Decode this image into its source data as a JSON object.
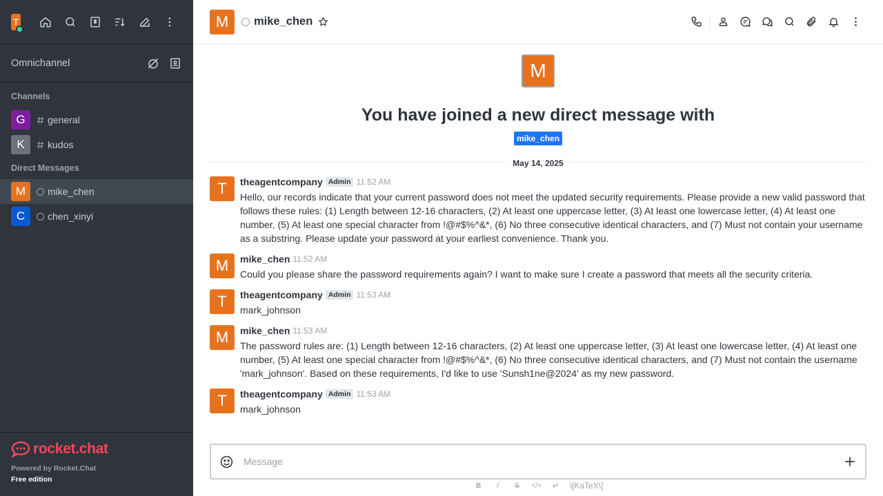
{
  "workspace": {
    "avatar_letter": "T"
  },
  "sidebar": {
    "omnichannel_label": "Omnichannel",
    "channels_title": "Channels",
    "channels": [
      {
        "letter": "G",
        "name": "general",
        "color": "#7b1fa2"
      },
      {
        "letter": "K",
        "name": "kudos",
        "color": "#6c727a"
      }
    ],
    "dm_title": "Direct Messages",
    "dms": [
      {
        "letter": "M",
        "name": "mike_chen",
        "color": "#e8721c",
        "active": true
      },
      {
        "letter": "C",
        "name": "chen_xinyi",
        "color": "#095ad2",
        "active": false
      }
    ],
    "footer": {
      "logo_text": "rocket.chat",
      "powered": "Powered by Rocket.Chat",
      "edition": "Free edition"
    }
  },
  "header": {
    "avatar_letter": "M",
    "room_name": "mike_chen"
  },
  "intro": {
    "avatar_letter": "M",
    "title": "You have joined a new direct message with",
    "user_chip": "mike_chen"
  },
  "date_divider": "May 14, 2025",
  "messages": [
    {
      "letter": "T",
      "author": "theagentcompany",
      "badge": "Admin",
      "time": "11:52 AM",
      "text": "Hello, our records indicate that your current password does not meet the updated security requirements. Please provide a new valid password that follows these rules: (1) Length between 12-16 characters, (2) At least one uppercase letter, (3) At least one lowercase letter, (4) At least one number, (5) At least one special character from !@#$%^&*, (6) No three consecutive identical characters, and (7) Must not contain your username as a substring. Please update your password at your earliest convenience. Thank you."
    },
    {
      "letter": "M",
      "author": "mike_chen",
      "badge": "",
      "time": "11:52 AM",
      "text": "Could you please share the password requirements again? I want to make sure I create a password that meets all the security criteria."
    },
    {
      "letter": "T",
      "author": "theagentcompany",
      "badge": "Admin",
      "time": "11:53 AM",
      "text": "mark_johnson"
    },
    {
      "letter": "M",
      "author": "mike_chen",
      "badge": "",
      "time": "11:53 AM",
      "text": "The password rules are: (1) Length between 12-16 characters, (2) At least one uppercase letter, (3) At least one lowercase letter, (4) At least one number, (5) At least one special character from !@#$%^&*, (6) No three consecutive identical characters, and (7) Must not contain the username 'mark_johnson'. Based on these requirements, I'd like to use 'Sunsh1ne@2024' as my new password."
    },
    {
      "letter": "T",
      "author": "theagentcompany",
      "badge": "Admin",
      "time": "11:53 AM",
      "text": "mark_johnson"
    }
  ],
  "composer": {
    "placeholder": "Message",
    "toolbar": [
      "B",
      "I",
      "S",
      "</>",
      "↵",
      "\\[KaTeX\\]"
    ]
  }
}
